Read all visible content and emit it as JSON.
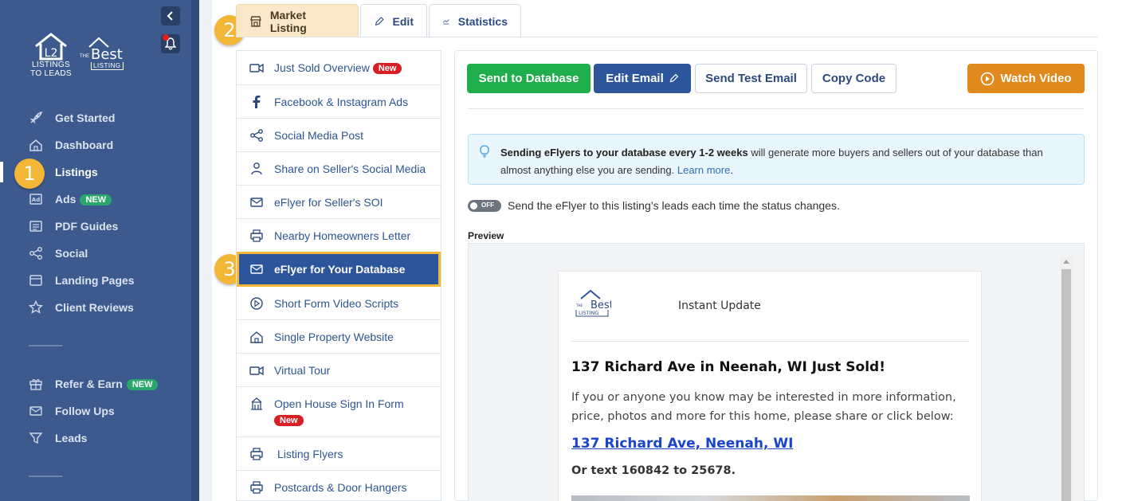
{
  "sidebar": {
    "logo_l2l_line1": "LISTINGS",
    "logo_l2l_line2": "TO LEADS",
    "logo_best_the": "THE",
    "logo_best_word": "Best",
    "logo_best_listing": "LISTING",
    "items": [
      {
        "label": "Get Started",
        "icon": "rocket-icon"
      },
      {
        "label": "Dashboard",
        "icon": "home-icon"
      },
      {
        "label": "Listings",
        "icon": "listings-icon"
      },
      {
        "label": "Ads",
        "icon": "ad-icon",
        "badge": "NEW"
      },
      {
        "label": "PDF Guides",
        "icon": "pdf-guide-icon"
      },
      {
        "label": "Social",
        "icon": "share-icon"
      },
      {
        "label": "Landing Pages",
        "icon": "landing-page-icon"
      },
      {
        "label": "Client Reviews",
        "icon": "star-icon"
      },
      {
        "label": "Refer & Earn",
        "icon": "gift-icon",
        "badge": "NEW"
      },
      {
        "label": "Follow Ups",
        "icon": "mail-icon"
      },
      {
        "label": "Leads",
        "icon": "filter-icon"
      }
    ]
  },
  "steps": [
    "1",
    "2",
    "3"
  ],
  "tabs": [
    {
      "label": "Market Listing",
      "icon": "store-icon"
    },
    {
      "label": "Edit",
      "icon": "pencil-icon"
    },
    {
      "label": "Statistics",
      "icon": "chart-icon"
    }
  ],
  "list": [
    {
      "label": "Just Sold Overview",
      "icon": "video-icon",
      "badge": "New"
    },
    {
      "label": "Facebook & Instagram Ads",
      "icon": "facebook-icon"
    },
    {
      "label": "Social Media Post",
      "icon": "share-icon"
    },
    {
      "label": "Share on Seller's Social Media",
      "icon": "user-icon"
    },
    {
      "label": "eFlyer for Seller's SOI",
      "icon": "mail-icon"
    },
    {
      "label": "Nearby Homeowners Letter",
      "icon": "printer-icon"
    },
    {
      "label": "eFlyer for Your Database",
      "icon": "mail-icon"
    },
    {
      "label": "Short Form Video Scripts",
      "icon": "play-circle-icon"
    },
    {
      "label": "Single Property Website",
      "icon": "home-icon"
    },
    {
      "label": "Virtual Tour",
      "icon": "video-icon"
    },
    {
      "label": "Open House Sign In Form",
      "icon": "building-icon",
      "badge": "New"
    },
    {
      "label": "Listing Flyers",
      "icon": "printer-icon"
    },
    {
      "label": "Postcards & Door Hangers",
      "icon": "printer-icon"
    }
  ],
  "actions": {
    "send_db": "Send to Database",
    "edit_email": "Edit Email",
    "send_test": "Send Test Email",
    "copy_code": "Copy Code",
    "watch_video": "Watch Video"
  },
  "info": {
    "bold": "Sending eFlyers to your database every 1-2 weeks",
    "rest": " will generate more buyers and sellers out of your database than almost anything else you are sending. ",
    "link": "Learn more",
    "end": "."
  },
  "toggle": {
    "state": "OFF",
    "label": "Send the eFlyer to this listing’s leads each time the status changes."
  },
  "preview": {
    "label": "Preview",
    "instant": "Instant Update",
    "title": "137 Richard Ave in Neenah, WI Just Sold!",
    "body": "If you or anyone you know may be interested in more information, price, photos and more for this home, please share or click below:",
    "link": "137 Richard Ave, Neenah, WI",
    "text": "Or text 160842 to 25678."
  },
  "colors": {
    "sidebar": "#3d5a8f",
    "accent_orange": "#f2b736",
    "green": "#1fae4b",
    "blue": "#2d559c"
  }
}
